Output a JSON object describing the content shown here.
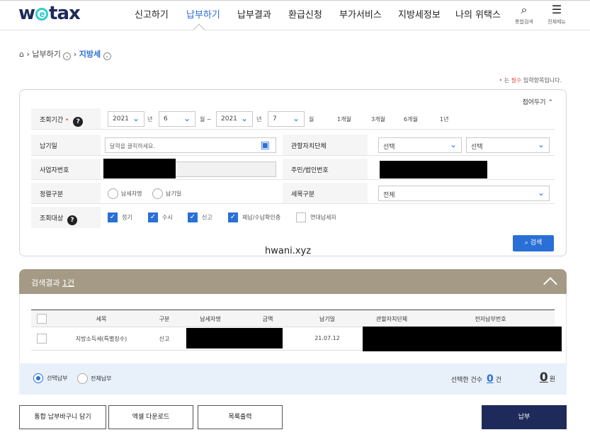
{
  "header": {
    "logo_prefix": "w",
    "logo_e": "e",
    "logo_suffix": "tax",
    "menu": [
      "신고하기",
      "납부하기",
      "납부결과",
      "환급신청",
      "부가서비스",
      "지방세정보",
      "나의 위택스"
    ],
    "active_menu": "납부하기",
    "search_label": "통합검색",
    "all_menu_label": "전체메뉴"
  },
  "breadcrumb": {
    "level1": "납부하기",
    "level2": "지방세"
  },
  "required_note": {
    "mark": "•",
    "prefix": " 는 ",
    "keyword": "필수",
    "suffix": " 입력항목입니다."
  },
  "search_panel": {
    "fold_label": "접어두기",
    "period_label": "조회기간",
    "from_year": "2021",
    "from_month": "6",
    "to_year": "2021",
    "to_month": "7",
    "year_unit": "년",
    "month_tilde": "월 ~",
    "month_unit": "월",
    "quick_ranges": [
      "1개월",
      "3개월",
      "6개월",
      "1년"
    ],
    "due_date_label": "납기일",
    "due_date_placeholder": "달력을 클릭하세요.",
    "local_gov_label": "관할자치단체",
    "local_gov_select1": "선택",
    "local_gov_select2": "선택",
    "biz_no_label": "사업자번호",
    "resident_no_label": "주민/법인번호",
    "sort_label": "정렬구분",
    "sort_options": [
      "납세자명",
      "납기일"
    ],
    "tax_type_label": "세목구분",
    "tax_type_value": "전체",
    "target_label": "조회대상",
    "targets": [
      {
        "label": "정기",
        "checked": true
      },
      {
        "label": "수시",
        "checked": true
      },
      {
        "label": "신고",
        "checked": true
      },
      {
        "label": "체납/수납확인중",
        "checked": true
      },
      {
        "label": "연대납세자",
        "checked": false
      }
    ],
    "search_button": "검색"
  },
  "watermark": "hwani.xyz",
  "results": {
    "title": "검색결과",
    "count": "1건",
    "columns": [
      "세목",
      "구분",
      "납세자명",
      "금액",
      "납기일",
      "관할자치단체",
      "전자납부번호"
    ],
    "rows": [
      {
        "tax_item": "지방소득세(특별징수)",
        "type": "신고",
        "due_date": "21.07.12"
      }
    ]
  },
  "footer": {
    "pay_options": [
      "선택납부",
      "전체납부"
    ],
    "selected_count_label": "선택한 건수",
    "selected_count": "0",
    "count_unit": "건",
    "amount": "0",
    "amount_unit": "원"
  },
  "actions": {
    "cart": "통합 납부바구니 담기",
    "excel": "엑셀 다운로드",
    "print": "목록출력",
    "pay": "납부"
  },
  "colors": {
    "accent": "#2a6fd6",
    "navy": "#1e2a5a",
    "result_header": "#a49a86",
    "required": "#e84d4d"
  }
}
